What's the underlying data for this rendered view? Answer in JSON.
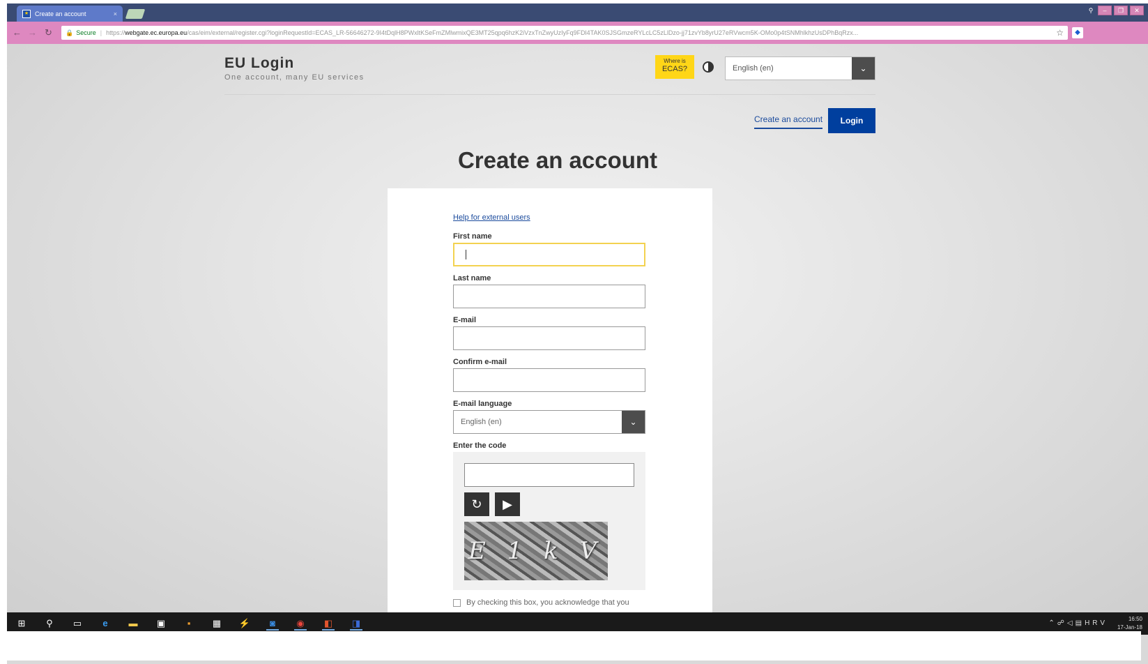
{
  "browser": {
    "tab_title": "Create an account",
    "tab_close": "×",
    "url_secure_label": "Secure",
    "url_scheme": "https://",
    "url_host": "webgate.ec.europa.eu",
    "url_path": "/cas/eim/external/register.cgi?loginRequestId=ECAS_LR-56646272-9I4tDqlH8PWxltKSeFmZMlwmixQE3MT25qpq6hzK2iVzxTnZwyUzIyFq9FDl4TAK0SJSGmzeRYLcLC5zLlDzo-jj71zvYb8yrU27eRVwcm5K-OMo0p4tSNMhlkhzUsDPhBqRzx..."
  },
  "header": {
    "app_title": "EU Login",
    "app_subtitle": "One account, many EU services",
    "ecas_line1": "Where is",
    "ecas_line2": "ECAS?",
    "language": "English (en)"
  },
  "nav": {
    "create_account": "Create an account",
    "login": "Login"
  },
  "page": {
    "title": "Create an account",
    "help_link": "Help for external users"
  },
  "form": {
    "first_name_label": "First name",
    "last_name_label": "Last name",
    "email_label": "E-mail",
    "confirm_email_label": "Confirm e-mail",
    "email_language_label": "E-mail language",
    "email_language_value": "English (en)",
    "code_label": "Enter the code",
    "captcha_text": "E 1 k V",
    "consent_text": "By checking this box, you acknowledge that you"
  },
  "taskbar": {
    "tray_lang": "HRV",
    "time": "16:50",
    "date": "17-Jan-18"
  },
  "colors": {
    "brand_blue": "#003f9e",
    "ecas_yellow": "#ffd617",
    "focus_yellow": "#f3d250",
    "address_bar": "#de88c0"
  }
}
